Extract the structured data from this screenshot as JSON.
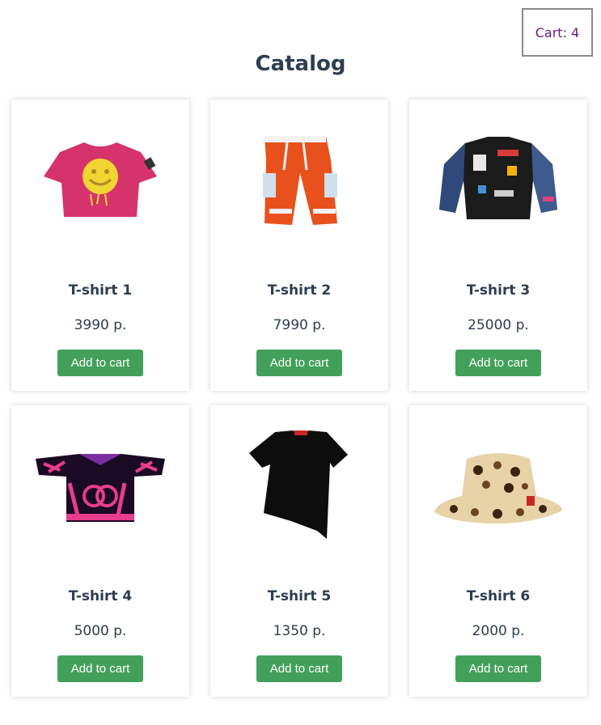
{
  "cart": {
    "label": "Cart: 4"
  },
  "page": {
    "title": "Catalog"
  },
  "products": [
    {
      "name": "T-shirt 1",
      "price": "3990 р.",
      "button": "Add to cart",
      "image": "pink-smiley-tshirt-icon"
    },
    {
      "name": "T-shirt 2",
      "price": "7990 р.",
      "button": "Add to cart",
      "image": "orange-cargo-pants-icon"
    },
    {
      "name": "T-shirt 3",
      "price": "25000 р.",
      "button": "Add to cart",
      "image": "patch-bomber-jacket-icon"
    },
    {
      "name": "T-shirt 4",
      "price": "5000 р.",
      "button": "Add to cart",
      "image": "pink-zebra-jersey-icon"
    },
    {
      "name": "T-shirt 5",
      "price": "1350 р.",
      "button": "Add to cart",
      "image": "black-asymmetric-tshirt-icon"
    },
    {
      "name": "T-shirt 6",
      "price": "2000 р.",
      "button": "Add to cart",
      "image": "leopard-bucket-hat-icon"
    }
  ],
  "colors": {
    "button": "#43a05a",
    "cart_text": "#6a1b7a",
    "heading": "#2c3e50"
  }
}
